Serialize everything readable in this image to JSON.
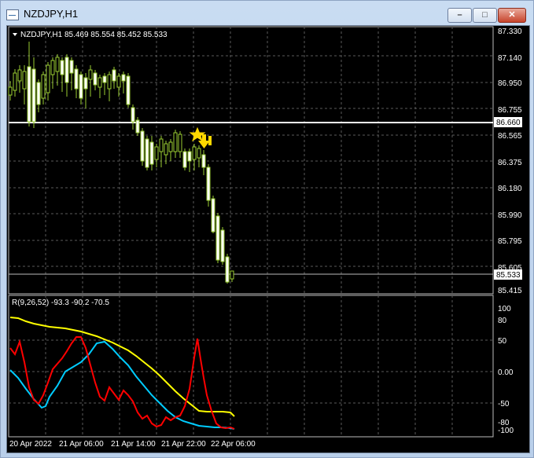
{
  "window": {
    "title": "NZDJPY,H1",
    "buttons": {
      "minimize": "–",
      "maximize": "□",
      "close": "✕"
    }
  },
  "chart": {
    "header": "NZDJPY,H1  85.469 85.554 85.452 85.533",
    "price_axis_labels": [
      "87.330",
      "87.140",
      "86.950",
      "86.755",
      "86.565",
      "86.375",
      "86.180",
      "85.990",
      "85.795",
      "85.605",
      "85.415"
    ],
    "hline_label": "86.660",
    "current_price_label": "85.533",
    "signal_icon": "arrow-down-star-icon"
  },
  "indicator": {
    "header": "R(9,26,52) -93.3 -90.2 -70.5",
    "axis_labels": [
      "100",
      "80",
      "50",
      "0.00",
      "-50",
      "-80",
      "-100"
    ]
  },
  "time_axis": {
    "labels": [
      "20 Apr 2022",
      "21 Apr 06:00",
      "21 Apr 14:00",
      "21 Apr 22:00",
      "22 Apr 06:00"
    ]
  },
  "colors": {
    "background": "#000000",
    "bull_candle": "#ffffff",
    "bear_candle": "#000000",
    "candle_outline": "#9acd32",
    "hline": "#ffffff",
    "signal": "#ffd800",
    "rsi_fast": "#ff0000",
    "rsi_mid": "#00ccff",
    "rsi_slow": "#ffff00",
    "grid": "#5a5a5a"
  }
}
